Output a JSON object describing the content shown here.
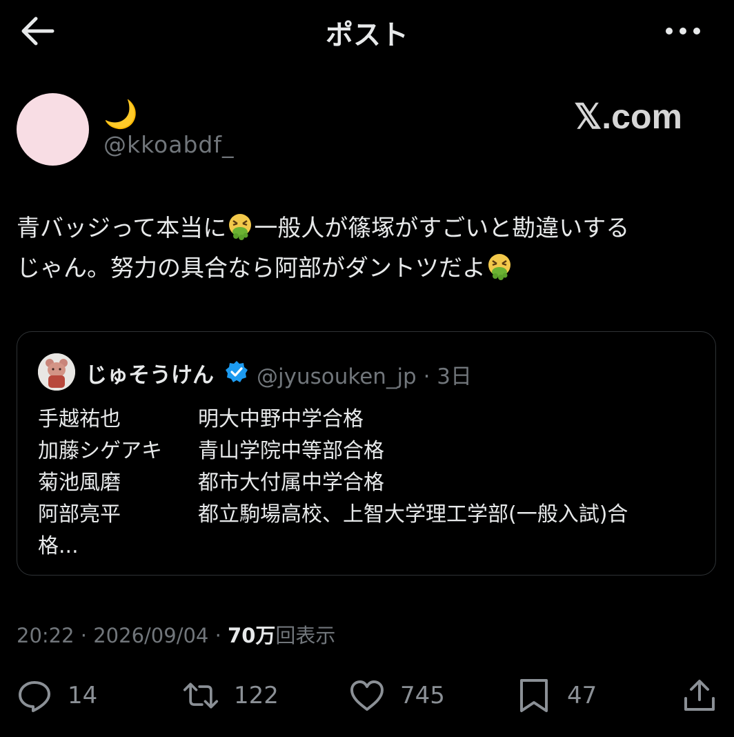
{
  "header": {
    "title": "ポスト",
    "back_icon": "arrow-left-icon",
    "more_icon": "more-horizontal-icon"
  },
  "author": {
    "display_name": "🌙",
    "handle": "@kkoabdf_",
    "avatar_color": "#f8dde4"
  },
  "watermark": "𝕏.com",
  "tweet": {
    "line1_before": "青バッジって本当に",
    "line1_after": "一般人が篠塚がすごいと勘違いする",
    "line2_before": "じゃん。努力の具合なら阿部がダントツだよ",
    "emoji": "nauseated-vomiting-face-icon"
  },
  "quote": {
    "name": "じゅそうけん",
    "handle_time": "@jyusouken_jp · 3日",
    "verified_color": "#1d9bf0",
    "rows": [
      {
        "name": "手越祐也",
        "result": "明大中野中学合格"
      },
      {
        "name": "加藤シゲアキ",
        "result": "青山学院中等部合格"
      },
      {
        "name": "菊池風磨",
        "result": "都市大付属中学合格"
      },
      {
        "name": "阿部亮平",
        "result": "都立駒場高校、上智大学理工学部(一般入試)合"
      }
    ],
    "overflow": "格..."
  },
  "meta": {
    "time_date": "20:22 · 2026/09/04 · ",
    "views_num": "70万",
    "views_label": "回表示"
  },
  "actions": {
    "replies": "14",
    "reposts": "122",
    "likes": "745",
    "bookmarks": "47"
  }
}
